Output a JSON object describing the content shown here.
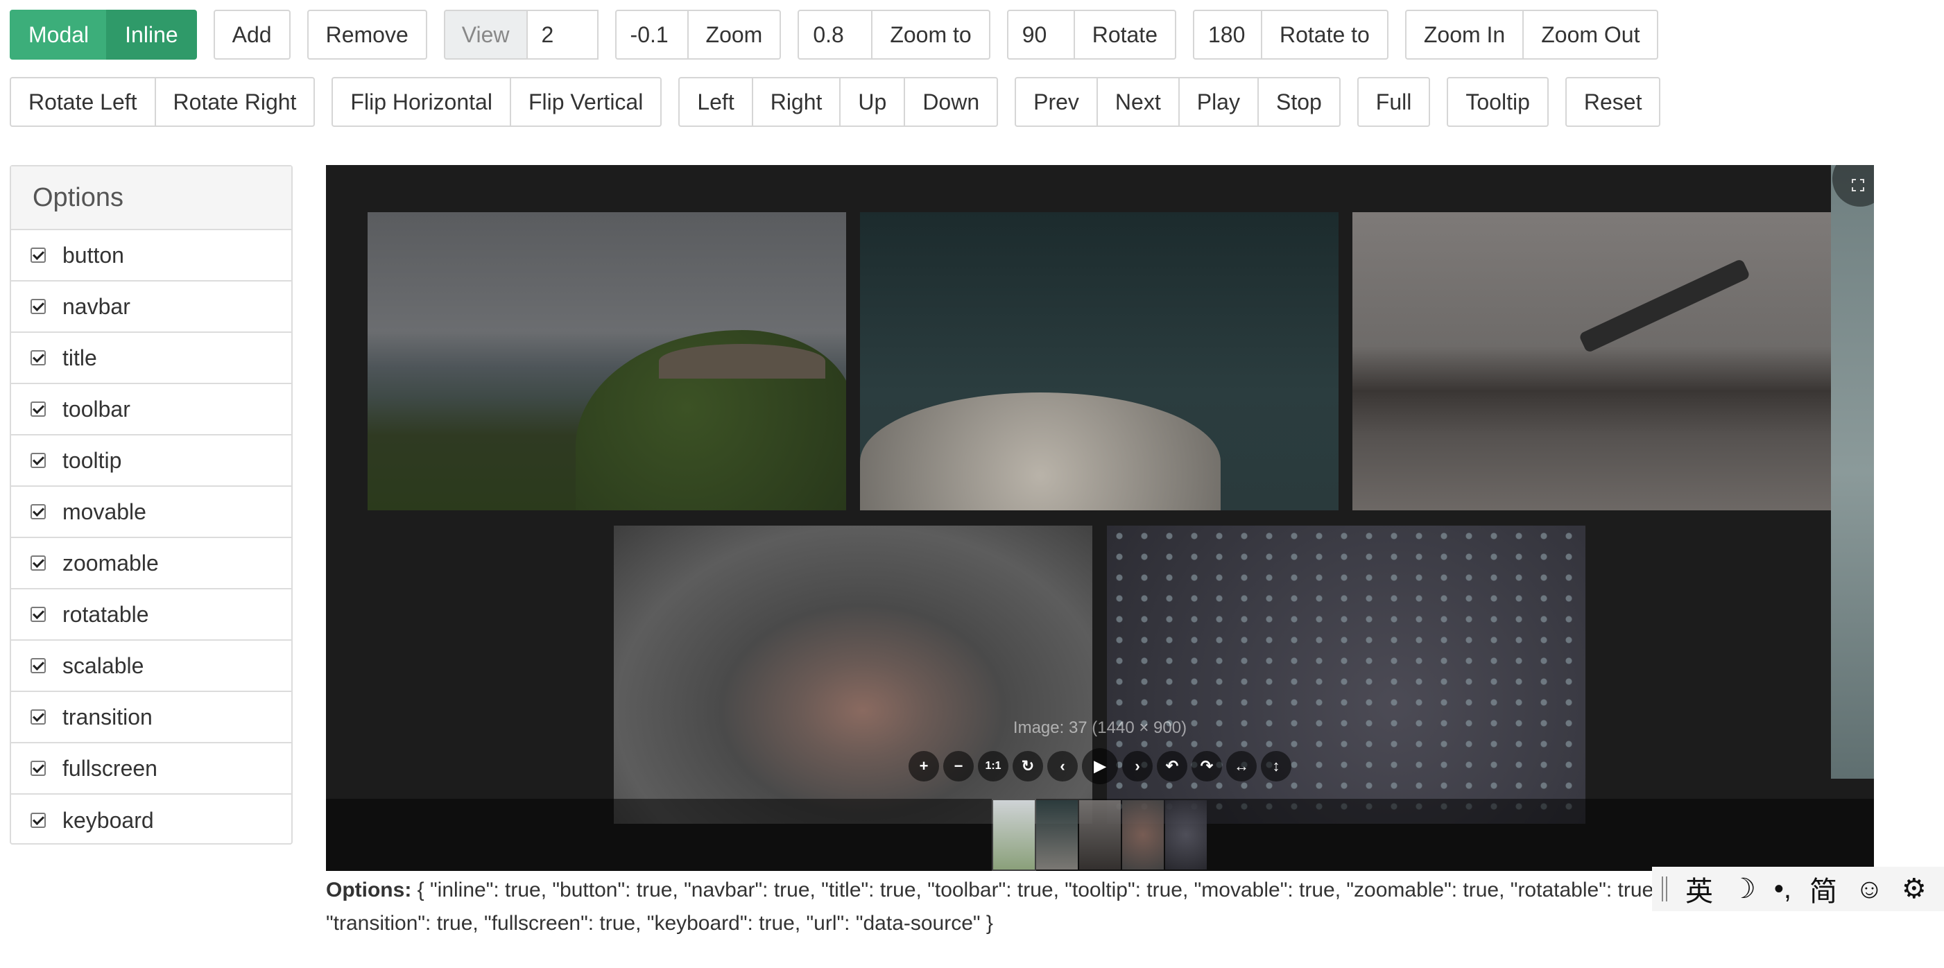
{
  "toolbar_row1": {
    "mode_modal": "Modal",
    "mode_inline": "Inline",
    "add": "Add",
    "remove": "Remove",
    "view_label": "View",
    "view_value": "2",
    "zoom_value": "-0.1",
    "zoom": "Zoom",
    "zoom_to_value": "0.8",
    "zoom_to": "Zoom to",
    "rotate_value": "90",
    "rotate": "Rotate",
    "rotate_to_value": "180",
    "rotate_to": "Rotate to",
    "zoom_in": "Zoom In",
    "zoom_out": "Zoom Out"
  },
  "toolbar_row2": {
    "rotate_left": "Rotate Left",
    "rotate_right": "Rotate Right",
    "flip_horizontal": "Flip Horizontal",
    "flip_vertical": "Flip Vertical",
    "left": "Left",
    "right": "Right",
    "up": "Up",
    "down": "Down",
    "prev": "Prev",
    "next": "Next",
    "play": "Play",
    "stop": "Stop",
    "full": "Full",
    "tooltip": "Tooltip",
    "reset": "Reset"
  },
  "options_panel": {
    "title": "Options",
    "items": [
      "button",
      "navbar",
      "title",
      "toolbar",
      "tooltip",
      "movable",
      "zoomable",
      "rotatable",
      "scalable",
      "transition",
      "fullscreen",
      "keyboard"
    ]
  },
  "viewer": {
    "image_title": "Image: 37 (1440 × 900)",
    "toolbar_icons": [
      "zoom-in-icon",
      "zoom-out-icon",
      "one-to-one-icon",
      "reset-icon",
      "prev-icon",
      "play-icon",
      "next-icon",
      "rotate-left-icon",
      "rotate-right-icon",
      "flip-horizontal-icon",
      "flip-vertical-icon"
    ],
    "toolbar_glyphs": [
      "+",
      "−",
      "1:1",
      "↻",
      "‹",
      "▶",
      "›",
      "↶",
      "↷",
      "↔",
      "↕"
    ]
  },
  "options_output": {
    "label": "Options:",
    "text": " { \"inline\": true, \"button\": true, \"navbar\": true, \"title\": true, \"toolbar\": true, \"tooltip\": true, \"movable\": true, \"zoomable\": true, \"rotatable\": true, \"scalable\": true, \"transition\": true, \"fullscreen\": true, \"keyboard\": true, \"url\": \"data-source\" }"
  },
  "ime_bar": {
    "lang": "英",
    "moon": "☽",
    "punct": "•,",
    "simplified": "简",
    "emoji": "☺",
    "settings": "⚙"
  },
  "colors": {
    "accent_green": "#3cae7a",
    "accent_green_active": "#2f9a69",
    "viewer_bg": "#1c1c1c"
  }
}
